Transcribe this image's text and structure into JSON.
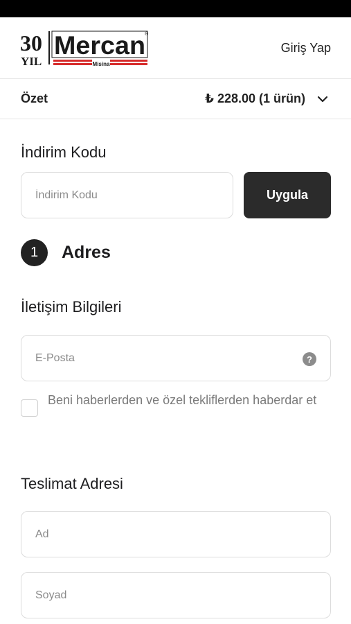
{
  "logo": {
    "years": "30",
    "yil": "YIL",
    "brand": "Mercan",
    "sub": "Misina",
    "registered": "®",
    "brand_color": "#d62b2b"
  },
  "header": {
    "login_label": "Giriş Yap"
  },
  "summary": {
    "label": "Özet",
    "price": "₺ 228.00 (1 ürün)"
  },
  "discount": {
    "title": "İndirim Kodu",
    "placeholder": "İndirim Kodu",
    "value": "",
    "apply_label": "Uygula"
  },
  "step": {
    "number": "1",
    "title": "Adres"
  },
  "contact": {
    "title": "İletişim Bilgileri",
    "email_placeholder": "E-Posta",
    "help_glyph": "?",
    "newsletter_label": "Beni haberlerden ve özel tekliflerden haberdar et",
    "newsletter_checked": false
  },
  "shipping": {
    "title": "Teslimat Adresi",
    "first_name_placeholder": "Ad",
    "last_name_placeholder": "Soyad"
  }
}
